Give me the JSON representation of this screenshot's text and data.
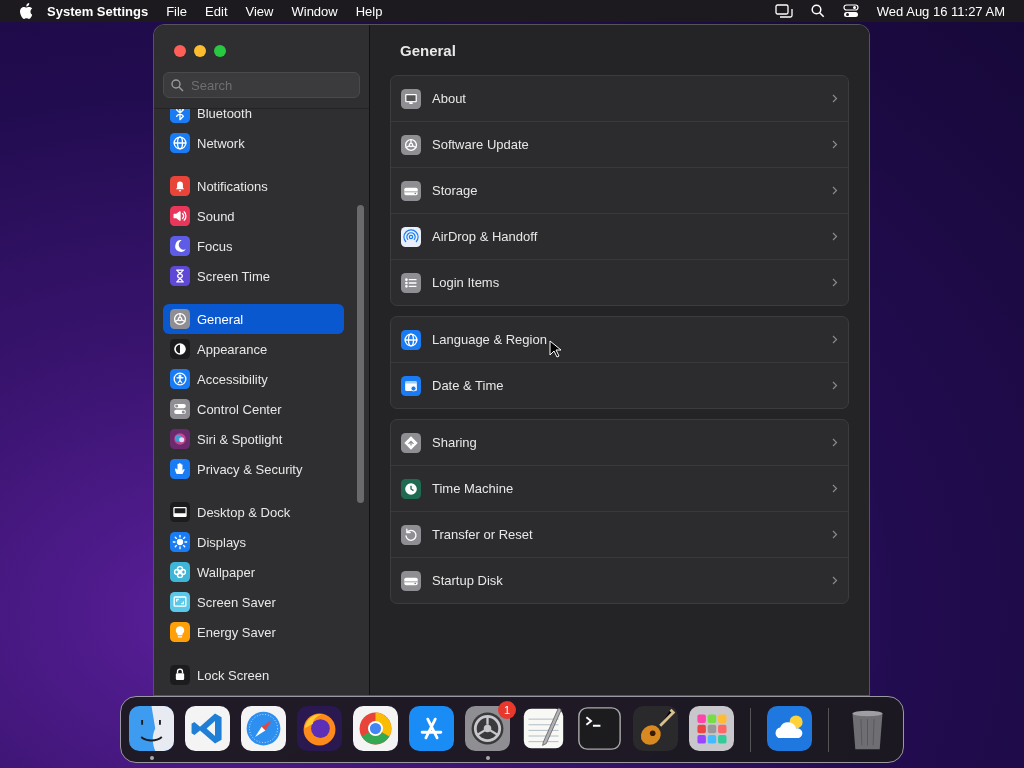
{
  "menubar": {
    "app_name": "System Settings",
    "menus": [
      "File",
      "Edit",
      "View",
      "Window",
      "Help"
    ],
    "clock": "Wed Aug 16 11:27 AM"
  },
  "sidebar": {
    "search": {
      "placeholder": "Search"
    },
    "groups": [
      {
        "items": [
          {
            "label": "Bluetooth",
            "kind": "bluetooth",
            "color": "#1a7cf5",
            "selected": false
          },
          {
            "label": "Network",
            "kind": "globe",
            "color": "#1a7cf5",
            "selected": false
          }
        ]
      },
      {
        "items": [
          {
            "label": "Notifications",
            "kind": "bell",
            "color": "#e8443a",
            "selected": false
          },
          {
            "label": "Sound",
            "kind": "speaker",
            "color": "#e8375a",
            "selected": false
          },
          {
            "label": "Focus",
            "kind": "moon",
            "color": "#5e5ce6",
            "selected": false
          },
          {
            "label": "Screen Time",
            "kind": "hourglass",
            "color": "#5e48d6",
            "selected": false
          }
        ]
      },
      {
        "items": [
          {
            "label": "General",
            "kind": "gear",
            "color": "#8e8e93",
            "selected": true
          },
          {
            "label": "Appearance",
            "kind": "contrast",
            "color": "#1c1c1e",
            "selected": false
          },
          {
            "label": "Accessibility",
            "kind": "person",
            "color": "#1a7cf5",
            "selected": false
          },
          {
            "label": "Control Center",
            "kind": "toggles",
            "color": "#8e8e93",
            "selected": false
          },
          {
            "label": "Siri & Spotlight",
            "kind": "orb",
            "color": "#6b2a6e",
            "selected": false
          },
          {
            "label": "Privacy & Security",
            "kind": "hand",
            "color": "#1a7cf5",
            "selected": false
          }
        ]
      },
      {
        "items": [
          {
            "label": "Desktop & Dock",
            "kind": "dock",
            "color": "#1c1c1e",
            "selected": false
          },
          {
            "label": "Displays",
            "kind": "sun",
            "color": "#1a7cf5",
            "selected": false
          },
          {
            "label": "Wallpaper",
            "kind": "flower",
            "color": "#3fb6d8",
            "selected": false
          },
          {
            "label": "Screen Saver",
            "kind": "screen",
            "color": "#5ac8e8",
            "selected": false
          },
          {
            "label": "Energy Saver",
            "kind": "bulb",
            "color": "#ff9f0a",
            "selected": false
          }
        ]
      },
      {
        "items": [
          {
            "label": "Lock Screen",
            "kind": "lock",
            "color": "#1c1c1e",
            "selected": false
          }
        ]
      }
    ]
  },
  "content": {
    "title": "General",
    "groups": [
      {
        "rows": [
          {
            "label": "About",
            "kind": "computer",
            "color": "#8e8e93"
          },
          {
            "label": "Software Update",
            "kind": "gear",
            "color": "#8e8e93"
          },
          {
            "label": "Storage",
            "kind": "drive",
            "color": "#8e8e93"
          },
          {
            "label": "AirDrop & Handoff",
            "kind": "rings",
            "color": "#e9f0fa"
          },
          {
            "label": "Login Items",
            "kind": "list",
            "color": "#8e8e93"
          }
        ]
      },
      {
        "rows": [
          {
            "label": "Language & Region",
            "kind": "globe",
            "color": "#1a7cf5"
          },
          {
            "label": "Date & Time",
            "kind": "calendar",
            "color": "#1a7cf5"
          }
        ]
      },
      {
        "rows": [
          {
            "label": "Sharing",
            "kind": "diamond",
            "color": "#8e8e93"
          },
          {
            "label": "Time Machine",
            "kind": "clock",
            "color": "#1f6b52"
          },
          {
            "label": "Transfer or Reset",
            "kind": "arrow",
            "color": "#8e8e93"
          },
          {
            "label": "Startup Disk",
            "kind": "drive",
            "color": "#8e8e93"
          }
        ]
      }
    ]
  },
  "dock": {
    "sections": [
      {
        "apps": [
          {
            "kind": "finder",
            "running": true
          },
          {
            "kind": "code",
            "running": false
          },
          {
            "kind": "compass",
            "running": false
          },
          {
            "kind": "fox",
            "running": false
          },
          {
            "kind": "tricolor",
            "running": false
          },
          {
            "kind": "asymbol",
            "running": false
          },
          {
            "kind": "gear",
            "running": true,
            "badge": "1"
          },
          {
            "kind": "notepad",
            "running": false
          },
          {
            "kind": "terminal",
            "running": false
          },
          {
            "kind": "guitar",
            "running": false
          },
          {
            "kind": "grid",
            "running": false
          }
        ]
      },
      {
        "apps": [
          {
            "kind": "weather",
            "running": false
          }
        ]
      },
      {
        "apps": [
          {
            "kind": "trash",
            "running": false
          }
        ]
      }
    ]
  }
}
